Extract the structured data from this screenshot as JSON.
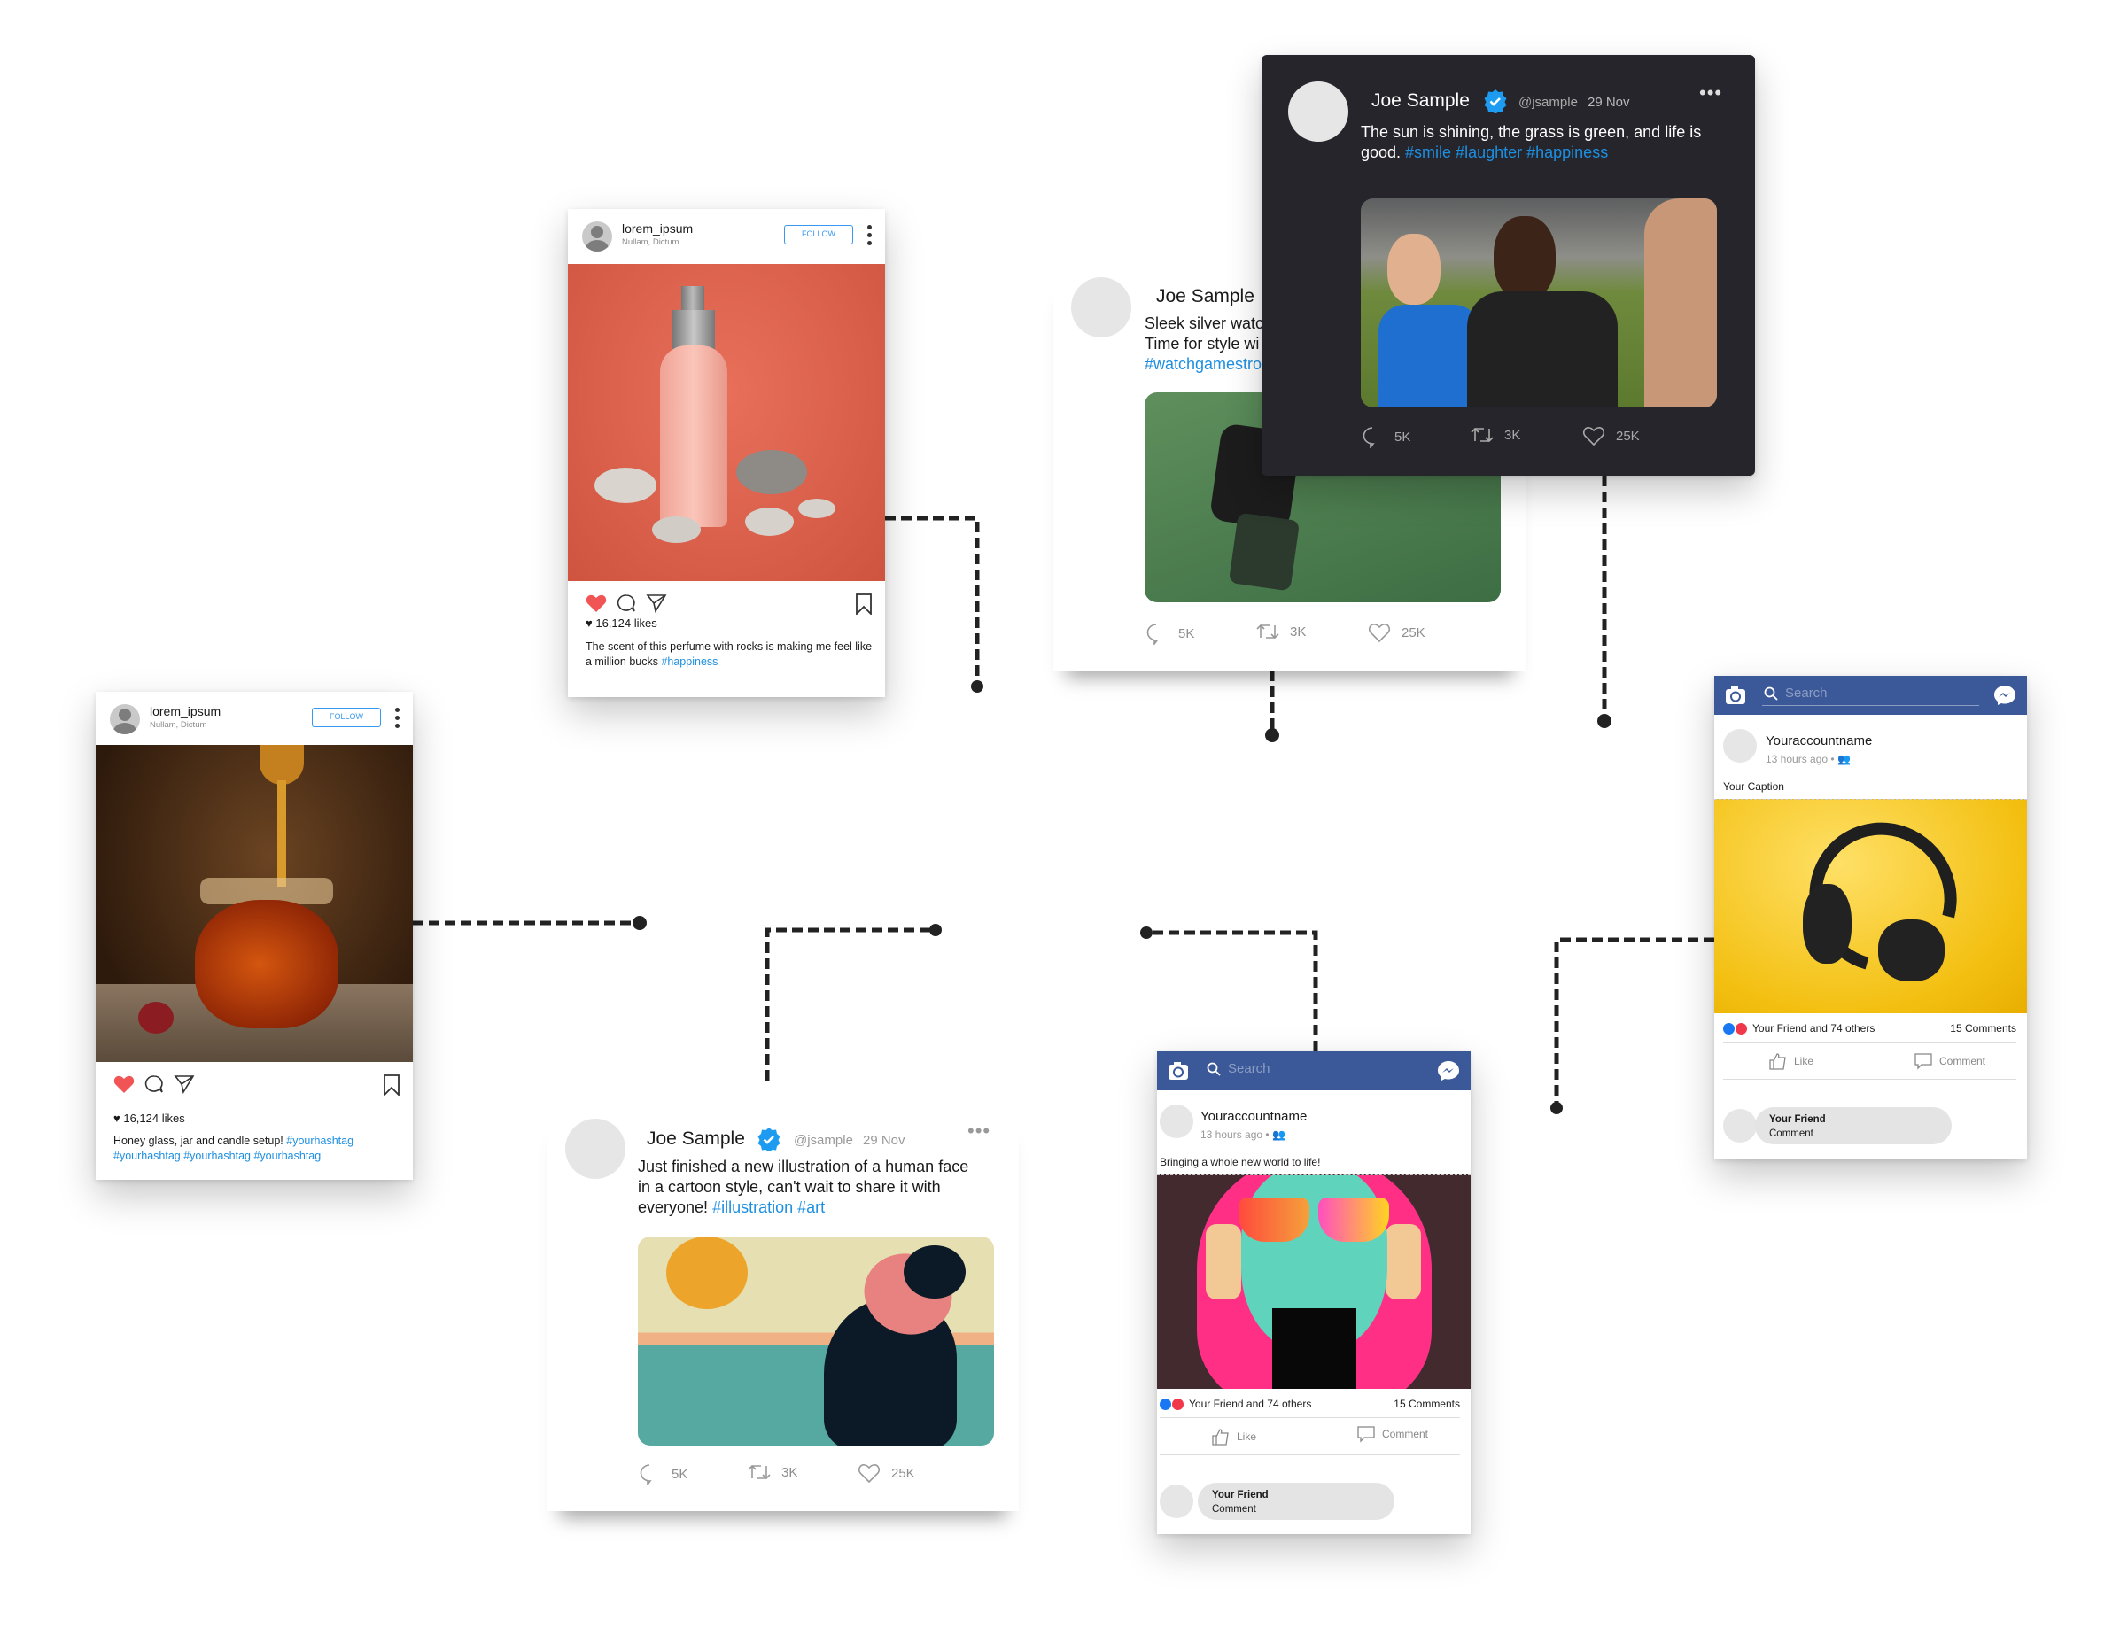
{
  "colors": {
    "link": "#1d8fe1",
    "facebook_blue": "#3b5998",
    "like_red": "#f05454",
    "dark_card": "#25252b",
    "connector": "#222222"
  },
  "instagram_posts": [
    {
      "username": "lorem_ipsum",
      "location": "Nullam, Dictum",
      "follow_label": "FOLLOW",
      "likes": "16,124 likes",
      "caption": "The scent of this perfume with rocks is making me feel like a million bucks ",
      "hashtags": "#happiness",
      "image": "perfume-bottle-with-stones"
    },
    {
      "username": "lorem_ipsum",
      "location": "Nullam, Dictum",
      "follow_label": "FOLLOW",
      "likes": "16,124 likes",
      "caption": "Honey glass, jar and candle setup! ",
      "hashtags": "#yourhashtag #yourhashtag  #yourhashtag  #yourhashtag",
      "image": "honey-jar"
    }
  ],
  "tweets": [
    {
      "name": "Joe Sample",
      "handle": "@jsample",
      "date": "29 Nov",
      "text": "The sun is shining, the grass is green, and life is good. ",
      "hashtags": "#smile #laughter #happiness",
      "replies": "5K",
      "retweets": "3K",
      "likes": "25K",
      "theme": "dark",
      "image": "friends-laughing"
    },
    {
      "name": "Joe Sample",
      "text_lines": [
        "Sleek silver watc",
        "Time for style wi"
      ],
      "hashtags": "#watchgamestro",
      "replies": "5K",
      "retweets": "3K",
      "likes": "25K",
      "theme": "light",
      "image": "smartwatch"
    },
    {
      "name": "Joe Sample",
      "handle": "@jsample",
      "date": "29 Nov",
      "text": "Just finished a new illustration of a human face in a cartoon style, can't wait to share it with everyone! ",
      "hashtags": "#illustration #art",
      "replies": "5K",
      "retweets": "3K",
      "likes": "25K",
      "theme": "light",
      "image": "woman-illustration-beach"
    }
  ],
  "facebook_posts": [
    {
      "search_placeholder": "Search",
      "account": "Youraccountname",
      "time": "13 hours ago",
      "caption": "Your Caption",
      "reactions": "Your Friend and 74 others",
      "comments": "15 Comments",
      "like_label": "Like",
      "comment_label": "Comment",
      "commenter": "Your Friend",
      "comment_text": "Comment",
      "image": "headphones-yellow"
    },
    {
      "search_placeholder": "Search",
      "account": "Youraccountname",
      "time": "13 hours ago",
      "caption": "Bringing a whole new world to life!",
      "reactions": "Your Friend and 74 others",
      "comments": "15 Comments",
      "like_label": "Like",
      "comment_label": "Comment",
      "commenter": "Your Friend",
      "comment_text": "Comment",
      "image": "face-with-sunglasses-art"
    }
  ]
}
